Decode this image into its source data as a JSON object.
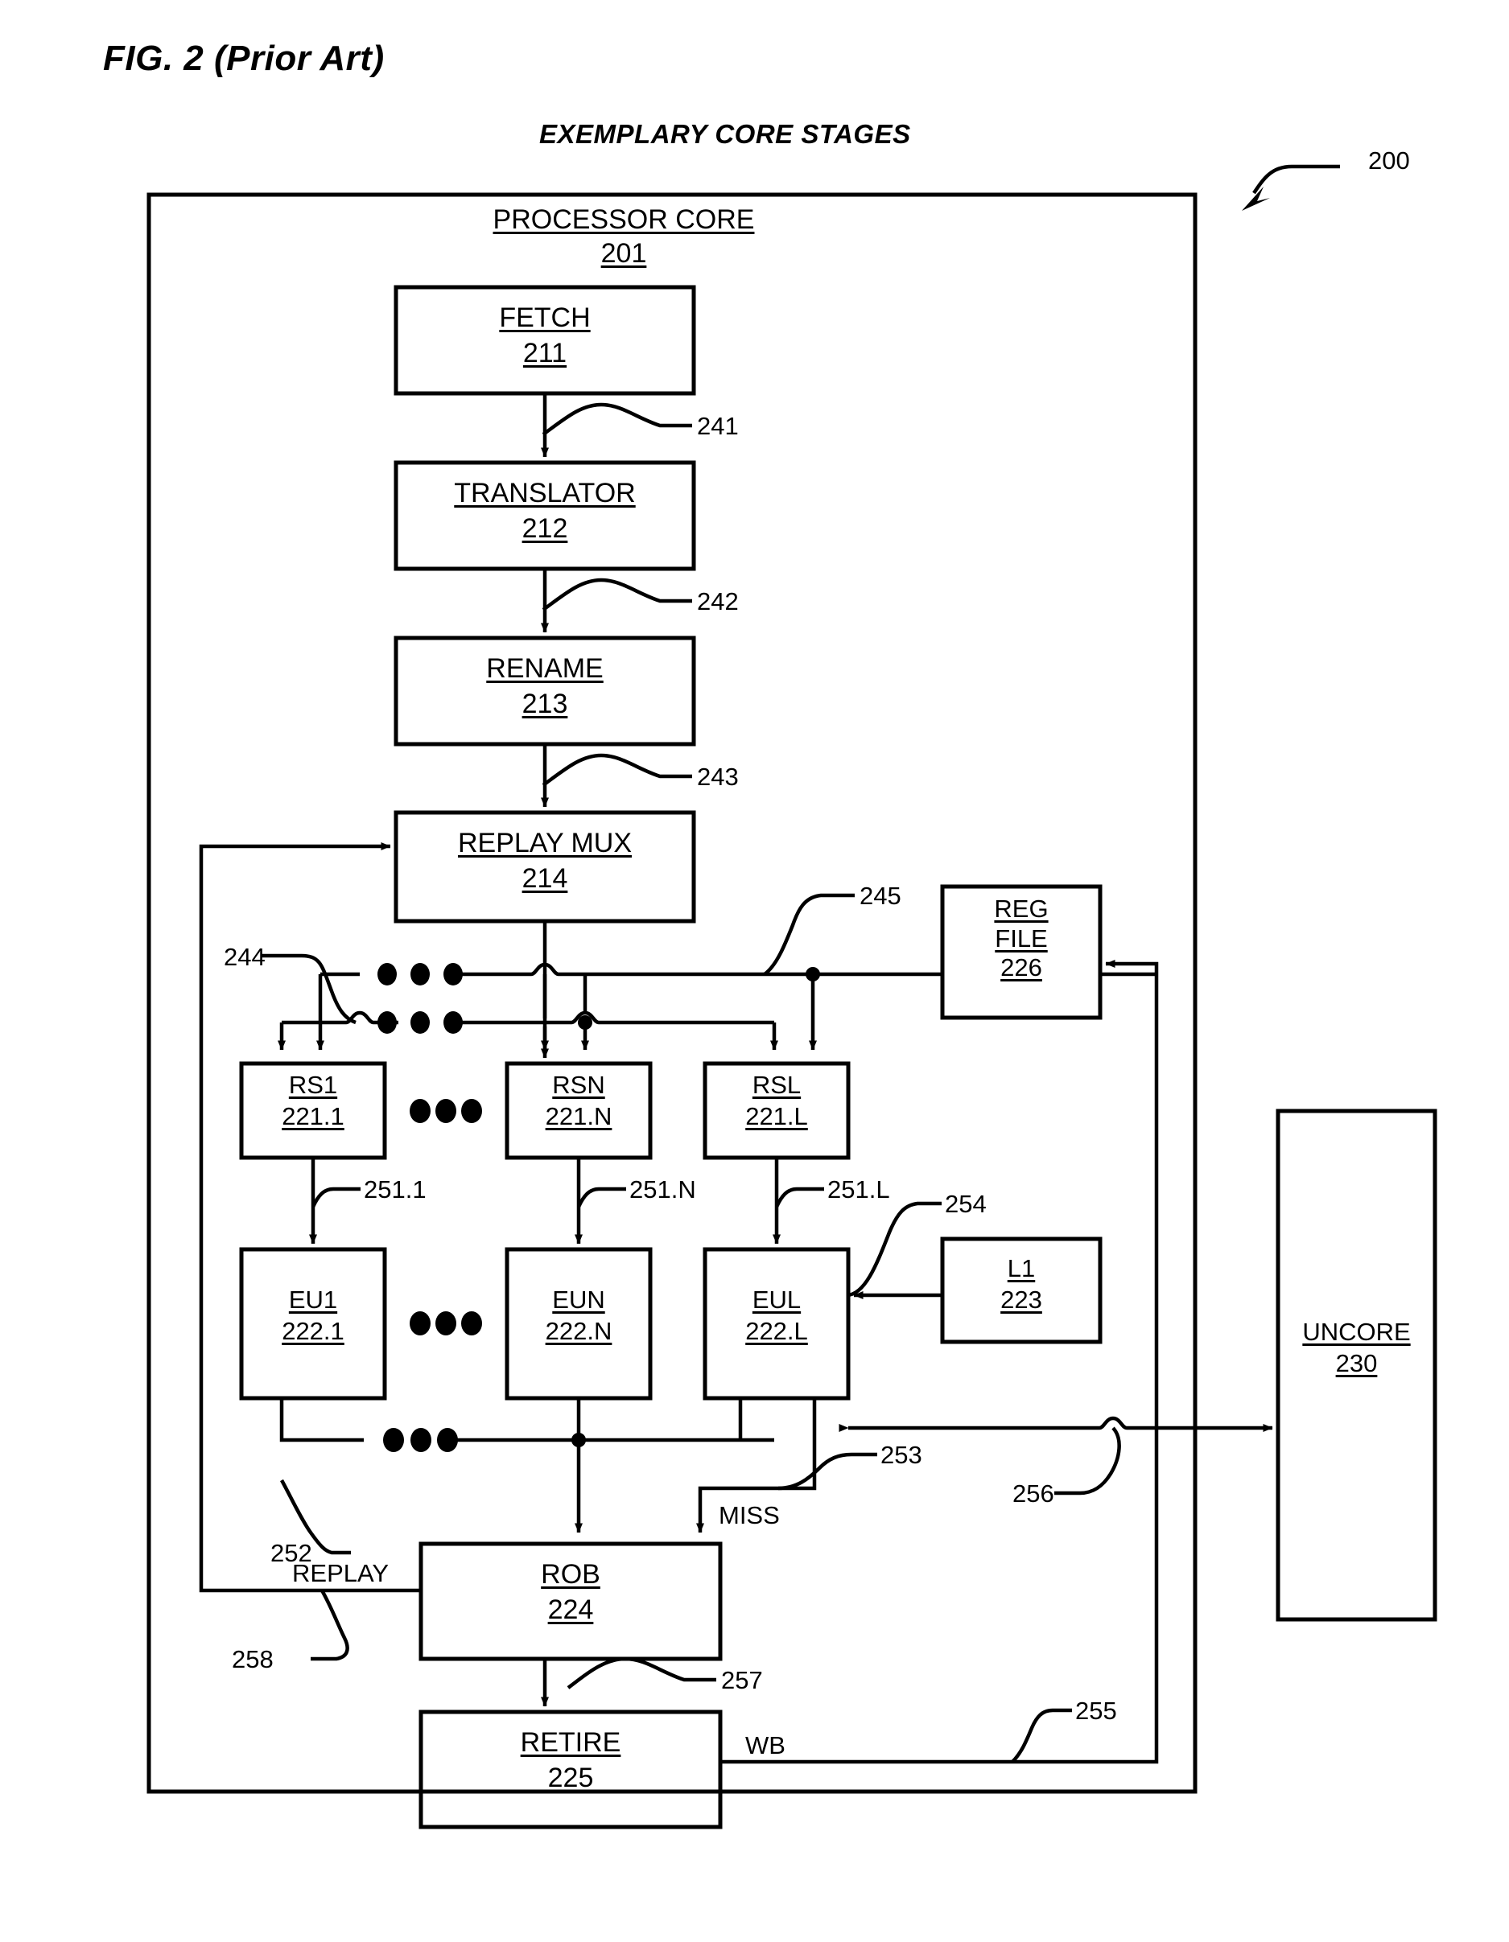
{
  "figure": {
    "fig_label": "FIG. 2 (Prior Art)",
    "diagram_title": "EXEMPLARY CORE STAGES",
    "overall_ref": "200"
  },
  "outer_block": {
    "title": "PROCESSOR CORE",
    "ref": "201"
  },
  "blocks": {
    "fetch": {
      "title": "FETCH",
      "ref": "211"
    },
    "translator": {
      "title": "TRANSLATOR",
      "ref": "212"
    },
    "rename": {
      "title": "RENAME",
      "ref": "213"
    },
    "replay_mux": {
      "title": "REPLAY MUX",
      "ref": "214"
    },
    "reg_file": {
      "title_line1": "REG",
      "title_line2": "FILE",
      "ref": "226"
    },
    "rs1": {
      "title": "RS1",
      "ref": "221.1"
    },
    "rsn": {
      "title": "RSN",
      "ref": "221.N"
    },
    "rsl": {
      "title": "RSL",
      "ref": "221.L"
    },
    "eu1": {
      "title": "EU1",
      "ref": "222.1"
    },
    "eun": {
      "title": "EUN",
      "ref": "222.N"
    },
    "eul": {
      "title": "EUL",
      "ref": "222.L"
    },
    "l1": {
      "title": "L1",
      "ref": "223"
    },
    "rob": {
      "title": "ROB",
      "ref": "224"
    },
    "retire": {
      "title": "RETIRE",
      "ref": "225"
    },
    "uncore": {
      "title": "UNCORE",
      "ref": "230"
    }
  },
  "signal_refs": {
    "s241": "241",
    "s242": "242",
    "s243": "243",
    "s244": "244",
    "s245": "245",
    "s251_1": "251.1",
    "s251_n": "251.N",
    "s251_l": "251.L",
    "s252": "252",
    "s253": "253",
    "s254": "254",
    "s255": "255",
    "s256": "256",
    "s257": "257",
    "s258": "258"
  },
  "signal_labels": {
    "miss": "MISS",
    "replay": "REPLAY",
    "wb": "WB"
  },
  "colors": {
    "ink": "#000000",
    "paper": "#ffffff"
  }
}
